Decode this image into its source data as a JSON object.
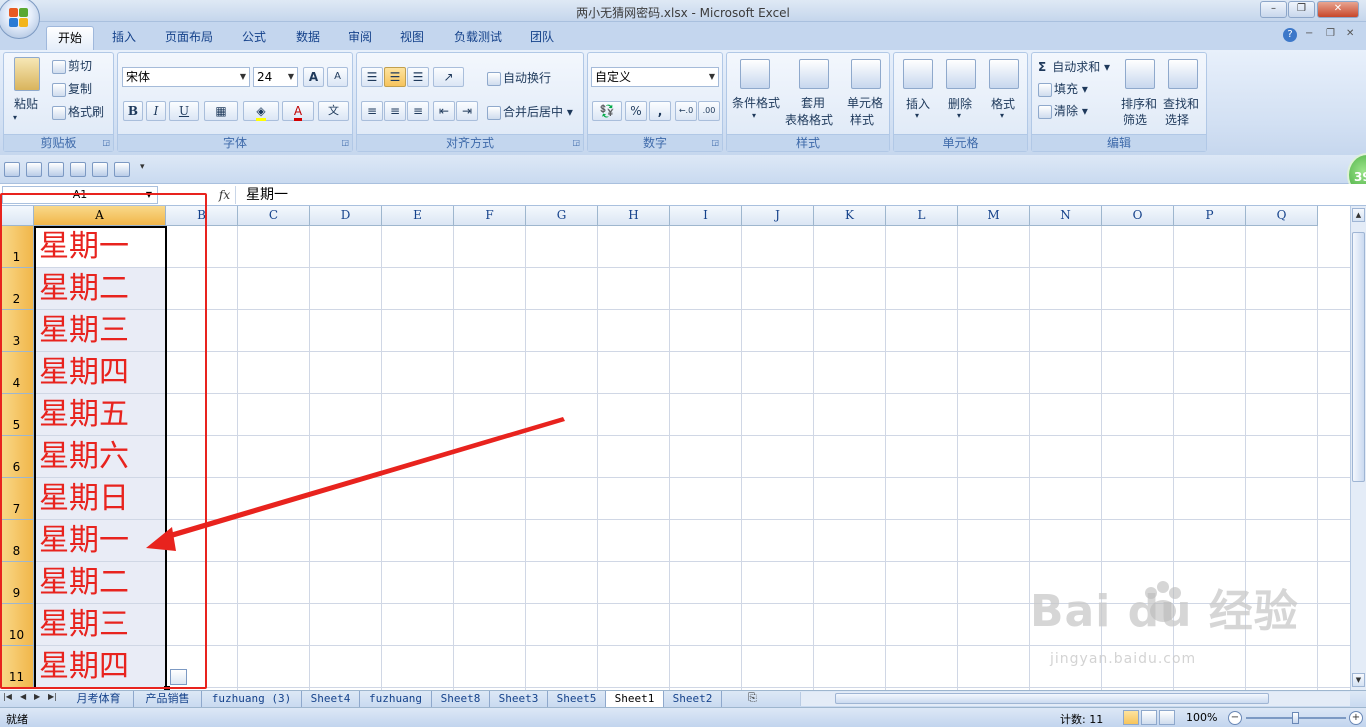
{
  "window": {
    "title": "两小无猜网密码.xlsx - Microsoft Excel",
    "controls": [
      "–",
      "❐",
      "✕"
    ]
  },
  "ribbon_tabs": [
    "开始",
    "插入",
    "页面布局",
    "公式",
    "数据",
    "审阅",
    "视图",
    "负载测试",
    "团队"
  ],
  "clipboard": {
    "paste": "粘贴",
    "cut": "剪切",
    "copy": "复制",
    "format_painter": "格式刷",
    "label": "剪贴板"
  },
  "font": {
    "name": "宋体",
    "size": "24",
    "label": "字体",
    "grow": "A",
    "shrink": "A",
    "bold": "B",
    "italic": "I",
    "underline": "U",
    "color_letter": "A",
    "wen": "文"
  },
  "alignment": {
    "wrap": "自动换行",
    "merge": "合并后居中",
    "label": "对齐方式"
  },
  "number": {
    "format": "自定义",
    "percent": "%",
    "comma": ",",
    "inc": "←.0",
    "dec": ".00",
    "label": "数字"
  },
  "styles": {
    "conditional": "条件格式",
    "table_1": "套用",
    "table_2": "表格格式",
    "cell_1": "单元格",
    "cell_2": "样式",
    "label": "样式"
  },
  "cells": {
    "insert": "插入",
    "delete": "删除",
    "format": "格式",
    "label": "单元格"
  },
  "editing": {
    "autosum": "自动求和",
    "fill": "填充",
    "clear": "清除",
    "sort_1": "排序和",
    "sort_2": "筛选",
    "find_1": "查找和",
    "find_2": "选择",
    "label": "编辑",
    "sigma": "Σ"
  },
  "badge": "39",
  "formula_bar": {
    "name_box": "A1",
    "fx": "fx",
    "content": "星期一"
  },
  "columns": [
    "A",
    "B",
    "C",
    "D",
    "E",
    "F",
    "G",
    "H",
    "I",
    "J",
    "K",
    "L",
    "M",
    "N",
    "O",
    "P",
    "Q"
  ],
  "rows": [
    "1",
    "2",
    "3",
    "4",
    "5",
    "6",
    "7",
    "8",
    "9",
    "10",
    "11"
  ],
  "cells_a": [
    "星期一",
    "星期二",
    "星期三",
    "星期四",
    "星期五",
    "星期六",
    "星期日",
    "星期一",
    "星期二",
    "星期三",
    "星期四"
  ],
  "sheet_tabs": [
    "月考体育",
    "产品销售",
    "fuzhuang (3)",
    "Sheet4",
    "fuzhuang",
    "Sheet8",
    "Sheet3",
    "Sheet5",
    "Sheet1",
    "Sheet2"
  ],
  "active_sheet": "Sheet1",
  "status": {
    "ready": "就绪",
    "count": "计数: 11",
    "zoom": "100%",
    "minus": "−",
    "plus": "+"
  },
  "watermark": {
    "main": "Bai du 经验",
    "sub": "jingyan.baidu.com"
  },
  "colors": {
    "accent": "#15428b",
    "cell_text": "#e8231e",
    "annotation": "#e8231e"
  }
}
